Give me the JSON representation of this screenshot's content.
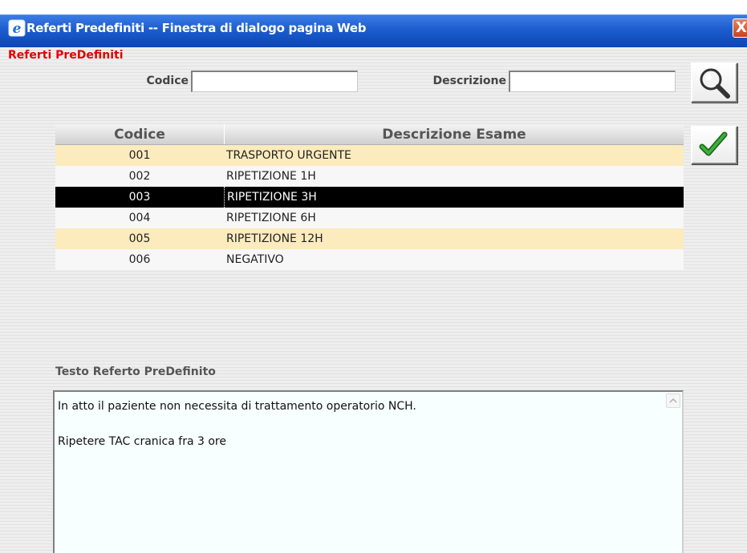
{
  "window": {
    "title": "Referti Predefiniti -- Finestra di dialogo pagina Web",
    "close_glyph": "X"
  },
  "header": {
    "label": "Referti PreDefiniti"
  },
  "search": {
    "codice_label": "Codice",
    "codice_value": "",
    "descrizione_label": "Descrizione",
    "descrizione_value": "",
    "search_icon": "magnifier-icon",
    "confirm_icon": "checkmark-icon"
  },
  "table": {
    "headers": {
      "codice": "Codice",
      "descrizione": "Descrizione Esame"
    },
    "rows": [
      {
        "codice": "001",
        "descrizione": "TRASPORTO URGENTE"
      },
      {
        "codice": "002",
        "descrizione": "RIPETIZIONE 1H"
      },
      {
        "codice": "003",
        "descrizione": "RIPETIZIONE 3H"
      },
      {
        "codice": "004",
        "descrizione": "RIPETIZIONE 6H"
      },
      {
        "codice": "005",
        "descrizione": "RIPETIZIONE 12H"
      },
      {
        "codice": "006",
        "descrizione": "NEGATIVO"
      }
    ],
    "selected_codice": "003"
  },
  "testo": {
    "label": "Testo Referto PreDefinito",
    "line1": "In atto il paziente non necessita di trattamento operatorio NCH.",
    "line2": "Ripetere TAC cranica fra 3 ore"
  },
  "colors": {
    "title_red": "#e00000",
    "row_highlight": "#fbebbd",
    "row_selected": "#000000"
  }
}
